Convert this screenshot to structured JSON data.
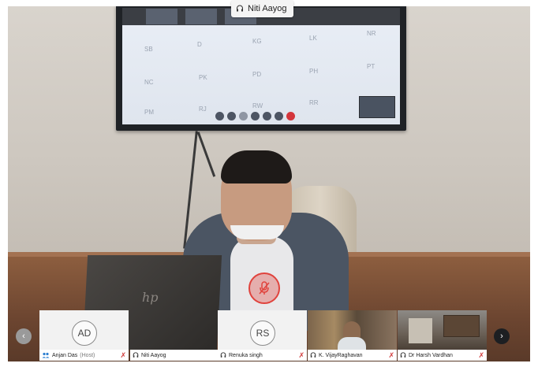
{
  "meeting": {
    "active_speaker_tag": "Niti Aayog",
    "screen_tiles": [
      "SB",
      "D",
      "KG",
      "LK",
      "NR",
      "NC",
      "PK",
      "PD",
      "PH",
      "PT",
      "PM",
      "RJ",
      "RW",
      "RR"
    ],
    "laptop_brand": "hp"
  },
  "participants": [
    {
      "initials": "AD",
      "name": "Anjan Das",
      "role": "(Host)",
      "has_video": false,
      "muted": true
    },
    {
      "initials": "",
      "name": "Niti Aayog",
      "role": "",
      "has_video": true,
      "muted": false
    },
    {
      "initials": "RS",
      "name": "Renuka singh",
      "role": "",
      "has_video": false,
      "muted": true
    },
    {
      "initials": "",
      "name": "K. VijayRaghavan",
      "role": "",
      "has_video": true,
      "muted": true
    },
    {
      "initials": "",
      "name": "Dr Harsh Vardhan",
      "role": "",
      "has_video": true,
      "muted": true
    }
  ],
  "nav": {
    "prev_icon": "chevron-left-icon",
    "next_icon": "chevron-right-icon"
  },
  "colors": {
    "mute_red": "#d23b3b",
    "strip_bg": "#f2f2f2"
  }
}
